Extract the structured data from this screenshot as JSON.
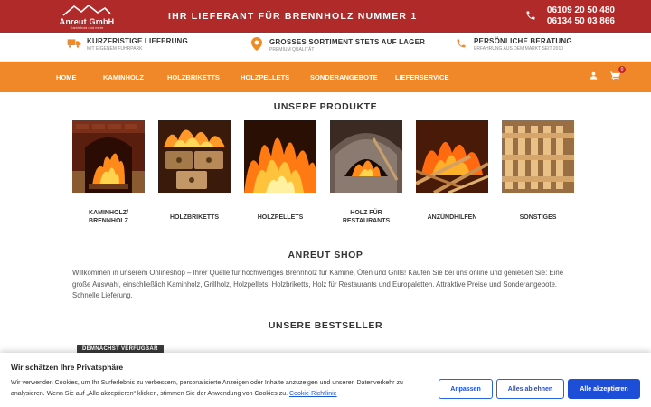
{
  "header": {
    "logo_name": "Anreut GmbH",
    "logo_sub": "Kaminholz und mehr",
    "tagline": "IHR LIEFERANT FÜR BRENNHOLZ NUMMER 1",
    "phone_1": "06109 20 50 480",
    "phone_2": "06134 50 03 866",
    "phone_icon": "phone-icon"
  },
  "features": [
    {
      "icon": "truck-icon",
      "title": "KURZFRISTIGE LIEFERUNG",
      "sub": "MIT EIGENEM FUHRPARK"
    },
    {
      "icon": "location-pin-icon",
      "title": "GROSSES SORTIMENT STETS AUF LAGER",
      "sub": "PREMIUM QUALITÄT"
    },
    {
      "icon": "phone-icon",
      "title": "PERSÖNLICHE BERATUNG",
      "sub": "ERFAHRUNG AUS DEM MARKT SEIT 2010"
    }
  ],
  "nav": {
    "items": [
      "HOME",
      "KAMINHOLZ",
      "HOLZBRIKETTS",
      "HOLZPELLETS",
      "SONDERANGEBOTE",
      "LIEFERSERVICE"
    ],
    "cart_count": "0"
  },
  "products_section": {
    "title": "UNSERE PRODUKTE",
    "items": [
      {
        "label_1": "KAMINHOLZ/",
        "label_2": "BRENNHOLZ"
      },
      {
        "label_1": "HOLZBRIKETTS",
        "label_2": ""
      },
      {
        "label_1": "HOLZPELLETS",
        "label_2": ""
      },
      {
        "label_1": "HOLZ FÜR",
        "label_2": "RESTAURANTS"
      },
      {
        "label_1": "ANZÜNDHILFEN",
        "label_2": ""
      },
      {
        "label_1": "SONSTIGES",
        "label_2": ""
      }
    ]
  },
  "shop": {
    "title": "ANREUT SHOP",
    "text": "Willkommen in unserem Onlineshop – Ihrer Quelle für hochwertiges Brennholz für Kamine, Öfen und Grills! Kaufen Sie bei uns online und genießen Sie: Eine große Auswahl, einschließlich Kaminholz, Grillholz, Holzpellets, Holzbriketts, Holz für Restaurants und Europaletten. Attraktive Preise und Sonderangebote. Schnelle Lieferung."
  },
  "bestseller": {
    "title": "UNSERE BESTSELLER",
    "badge": "DEMNÄCHST VERFÜGBAR"
  },
  "cookie": {
    "title": "Wir schätzen Ihre Privatsphäre",
    "text": "Wir verwenden Cookies, um Ihr Surferlebnis zu verbessern, personalisierte Anzeigen oder Inhalte anzuzeigen und unseren Datenverkehr zu analysieren. Wenn Sie auf „Alle akzeptieren“ klicken, stimmen Sie der Anwendung von Cookies zu.",
    "link": "Cookie-Richtlinie",
    "btn_customize": "Anpassen",
    "btn_reject": "Alles ablehnen",
    "btn_accept": "Alle akzeptieren"
  },
  "colors": {
    "topbar": "#b02a2a",
    "nav": "#f0882a",
    "accent_blue": "#1d4ed8"
  }
}
